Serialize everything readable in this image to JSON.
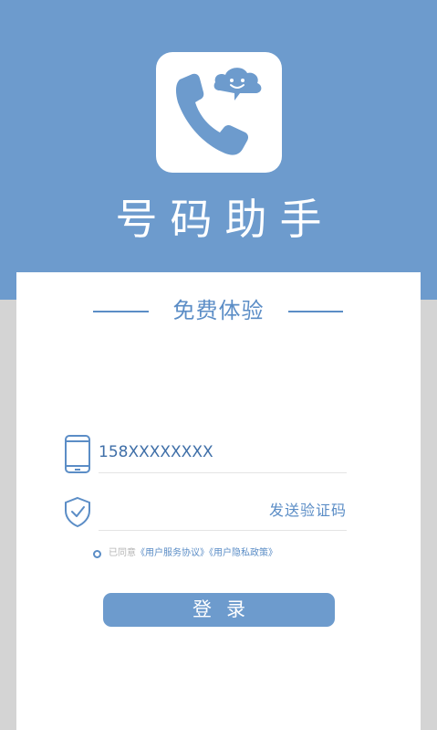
{
  "header": {
    "app_title": "号码助手",
    "icon": "phone-chat-icon"
  },
  "card": {
    "section_title": "免费体验",
    "phone_field": {
      "value": "158XXXXXXXX",
      "icon": "mobile-phone-icon"
    },
    "code_field": {
      "value": "",
      "icon": "shield-check-icon",
      "send_code_label": "发送验证码"
    },
    "agreement": {
      "prefix": "已同意",
      "service_link": "《用户服务协议》",
      "privacy_link": "《用户隐私政策》"
    },
    "login_label": "登录"
  },
  "colors": {
    "brand_blue": "#6d9bcd",
    "accent_blue": "#5b8dc6",
    "background_gray": "#d4d4d4"
  }
}
